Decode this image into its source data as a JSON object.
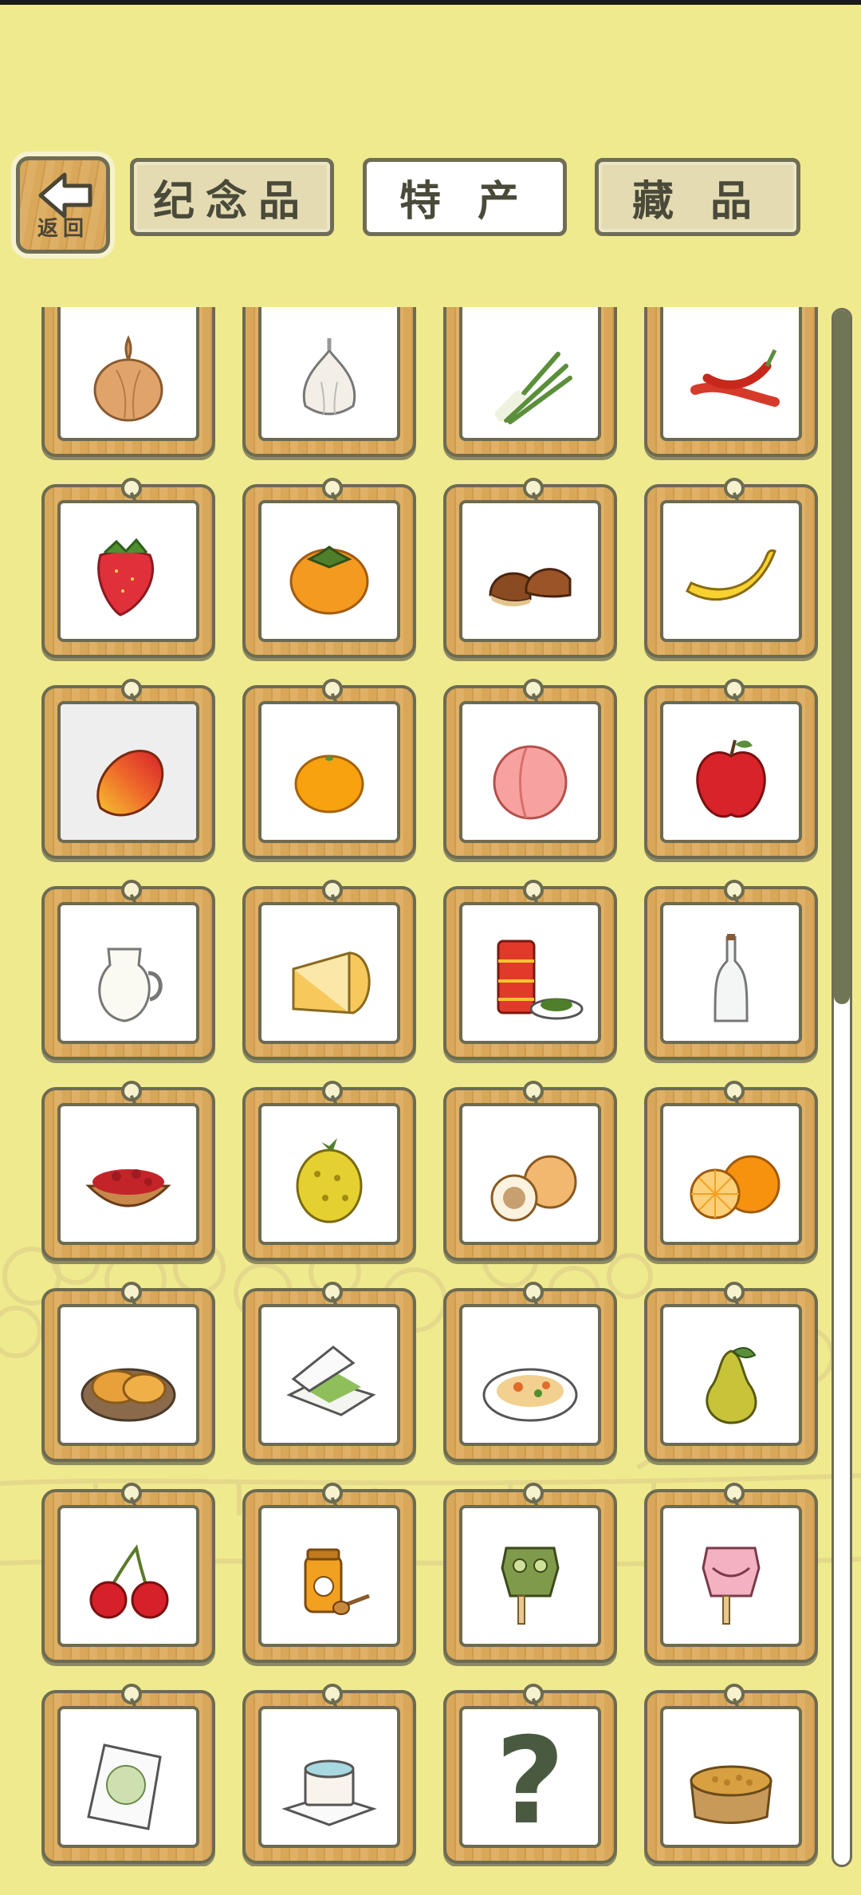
{
  "back": {
    "label": "返回",
    "icon": "arrow-left-icon"
  },
  "tabs": [
    {
      "label": "纪念品",
      "active": false
    },
    {
      "label": "特 产",
      "active": true
    },
    {
      "label": "藏 品",
      "active": false
    }
  ],
  "colors": {
    "background": "#f0ea8e",
    "frame": "#d8a759",
    "outline": "#6c6b52",
    "scroll_thumb": "#6f7555"
  },
  "items": [
    {
      "name": "onion"
    },
    {
      "name": "garlic"
    },
    {
      "name": "green-onion"
    },
    {
      "name": "chili-peppers"
    },
    {
      "name": "strawberry"
    },
    {
      "name": "persimmon"
    },
    {
      "name": "chestnuts"
    },
    {
      "name": "banana"
    },
    {
      "name": "mango",
      "selected": true
    },
    {
      "name": "mandarin-orange"
    },
    {
      "name": "peach"
    },
    {
      "name": "apple"
    },
    {
      "name": "milk-jug"
    },
    {
      "name": "cheese"
    },
    {
      "name": "tea-tins-and-leaves"
    },
    {
      "name": "glass-bottle"
    },
    {
      "name": "goji-berries"
    },
    {
      "name": "horned-melon"
    },
    {
      "name": "cantaloupe"
    },
    {
      "name": "orange"
    },
    {
      "name": "flatbread"
    },
    {
      "name": "bento-box"
    },
    {
      "name": "noodle-dish"
    },
    {
      "name": "pear"
    },
    {
      "name": "cherries"
    },
    {
      "name": "honey-jar"
    },
    {
      "name": "bronze-mask-popsicle"
    },
    {
      "name": "pink-popsicle"
    },
    {
      "name": "snack-bag"
    },
    {
      "name": "cake"
    },
    {
      "name": "unknown",
      "label": "?"
    },
    {
      "name": "bean-bowl"
    }
  ],
  "scroll": {
    "position_fraction": 0.45
  }
}
